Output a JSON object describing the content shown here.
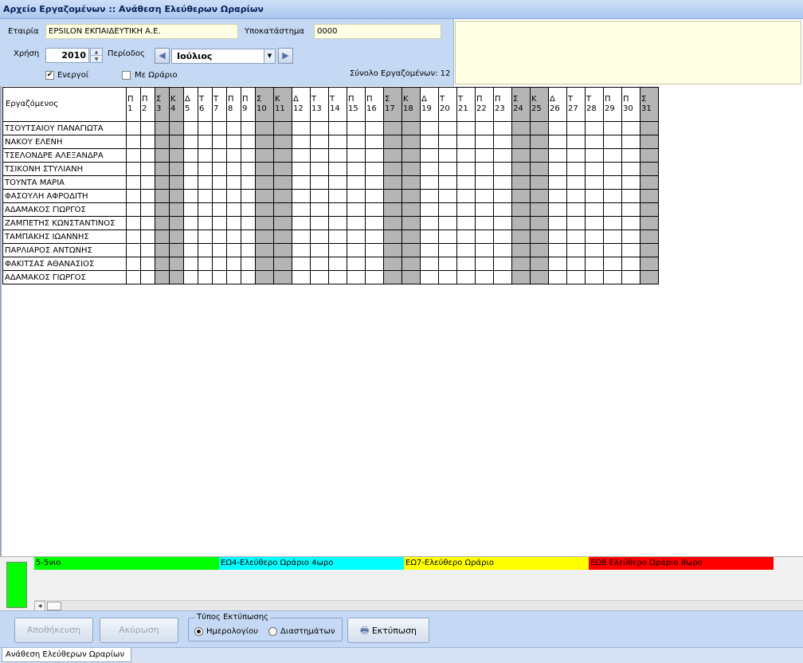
{
  "window": {
    "title": "Αρχείο Εργαζομένων :: Ανάθεση Ελεύθερων Ωραρίων"
  },
  "header": {
    "company_label": "Εταιρία",
    "company_value": "EPSILON ΕΚΠΑΙΔΕΥΤΙΚΗ Α.Ε.",
    "branch_label": "Υποκατάστημα",
    "branch_value": "0000",
    "year_label": "Χρήση",
    "year_value": "2010",
    "period_label": "Περίοδος",
    "period_value": "Ιούλιος",
    "active_label": "Ενεργοί",
    "active_checked": true,
    "schedule_label": "Με Ωράριο",
    "schedule_checked": false,
    "total_text": "Σύνολο Εργαζομένων: 12"
  },
  "grid": {
    "employee_header": "Εργαζόμενος",
    "days": [
      {
        "d": "Π",
        "n": "1",
        "we": false
      },
      {
        "d": "Π",
        "n": "2",
        "we": false
      },
      {
        "d": "Σ",
        "n": "3",
        "we": true
      },
      {
        "d": "Κ",
        "n": "4",
        "we": true
      },
      {
        "d": "Δ",
        "n": "5",
        "we": false
      },
      {
        "d": "Τ",
        "n": "6",
        "we": false
      },
      {
        "d": "Τ",
        "n": "7",
        "we": false
      },
      {
        "d": "Π",
        "n": "8",
        "we": false
      },
      {
        "d": "Π",
        "n": "9",
        "we": false
      },
      {
        "d": "Σ",
        "n": "10",
        "we": true
      },
      {
        "d": "Κ",
        "n": "11",
        "we": true
      },
      {
        "d": "Δ",
        "n": "12",
        "we": false
      },
      {
        "d": "Τ",
        "n": "13",
        "we": false
      },
      {
        "d": "Τ",
        "n": "14",
        "we": false
      },
      {
        "d": "Π",
        "n": "15",
        "we": false
      },
      {
        "d": "Π",
        "n": "16",
        "we": false
      },
      {
        "d": "Σ",
        "n": "17",
        "we": true
      },
      {
        "d": "Κ",
        "n": "18",
        "we": true
      },
      {
        "d": "Δ",
        "n": "19",
        "we": false
      },
      {
        "d": "Τ",
        "n": "20",
        "we": false
      },
      {
        "d": "Τ",
        "n": "21",
        "we": false
      },
      {
        "d": "Π",
        "n": "22",
        "we": false
      },
      {
        "d": "Π",
        "n": "23",
        "we": false
      },
      {
        "d": "Σ",
        "n": "24",
        "we": true
      },
      {
        "d": "Κ",
        "n": "25",
        "we": true
      },
      {
        "d": "Δ",
        "n": "26",
        "we": false
      },
      {
        "d": "Τ",
        "n": "27",
        "we": false
      },
      {
        "d": "Τ",
        "n": "28",
        "we": false
      },
      {
        "d": "Π",
        "n": "29",
        "we": false
      },
      {
        "d": "Π",
        "n": "30",
        "we": false
      },
      {
        "d": "Σ",
        "n": "31",
        "we": true
      }
    ],
    "employees": [
      "ΤΣΟΥΤΣΑΙΟΥ ΠΑΝΑΓΙΩΤΑ",
      "ΝΑΚΟΥ ΕΛΕΝΗ",
      "ΤΣΕΛΟΝΔΡΕ ΑΛΕΞΑΝΔΡΑ",
      "ΤΣΙΚΟΝΗ ΣΤΥΛΙΑΝΗ",
      "ΤΟΥΝΤΑ ΜΑΡΙΑ",
      "ΦΑΣΟΥΛΗ ΑΦΡΟΔΙΤΗ",
      "ΑΔΑΜΑΚΟΣ ΓΙΩΡΓΟΣ",
      "ΖΑΜΠΕΤΗΣ ΚΩΝΣΤΑΝΤΙΝΟΣ",
      "ΤΑΜΠΑΚΗΣ ΙΩΑΝΝΗΣ",
      "ΠΑΡΛΙΑΡΟΣ ΑΝΤΩΝΗΣ",
      "ΦΑΚΙΤΣΑΣ ΑΘΑΝΑΣΙΟΣ",
      "ΑΔΑΜΑΚΟΣ ΓΙΩΡΓΟΣ"
    ]
  },
  "legend": {
    "swatch_color": "#00ff00",
    "items": [
      {
        "label": "5-5νιο",
        "color": "#00ff00"
      },
      {
        "label": "ΕΩ4-Ελεύθερο Ωράριο 4ωρο",
        "color": "#00ffff"
      },
      {
        "label": "ΕΩ7-Ελεύθερο Ωράριο",
        "color": "#ffff00"
      },
      {
        "label": "ΕΩ8 Ελεύθερο Ωράριο 8ωρο",
        "color": "#ff0000"
      }
    ]
  },
  "toolbar": {
    "save_label": "Αποθήκευση",
    "cancel_label": "Ακύρωση",
    "print_type_label": "Τύπος Εκτύπωσης",
    "radio_calendar_label": "Ημερολογίου",
    "radio_interval_label": "Διαστημάτων",
    "print_label": "Εκτύπωση"
  },
  "tabs": [
    {
      "label": "Ανάθεση Ελεύθερων Ωραρίων"
    }
  ],
  "icons": {
    "prev": "triangle-left-icon",
    "next": "triangle-right-icon",
    "combo": "chevron-down-icon",
    "printer": "printer-icon"
  },
  "colors": {
    "weekend": "#b5b5b5",
    "panel": "#c5d9f4",
    "field": "#ffffe6"
  }
}
